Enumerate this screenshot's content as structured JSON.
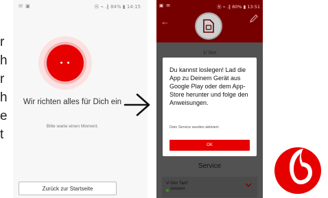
{
  "slide_text_chars": [
    "r",
    "h",
    "r",
    "h",
    "e",
    "t"
  ],
  "phone1": {
    "status_left": "✉ ▣",
    "status_right": "Ⓝ ⌁ .∥ 84% ▮ 14:15",
    "title": "Wir richten alles für Dich ein",
    "subtitle": "Bitte warte einen Moment.",
    "back_button": "Zurück zur Startseite"
  },
  "phone2": {
    "status_left": "▣ ✉",
    "status_right": "Ⓝ ⌁ .∥ 80% ▮ 13:51",
    "back_icon": "←",
    "sim_name": "1/ Sim",
    "dialog": {
      "message": "Du kannst loslegen! Lad die App zu Deinem Gerät aus Google Play oder dem App-Store herunter und folge den Anweisungen.",
      "note": "Dein Service wurden aktiviert.",
      "ok_label": "OK"
    },
    "service_heading": "Service",
    "tariff_name": "V-Sim Tarif",
    "tariff_status": "Aktiviert"
  },
  "colors": {
    "vodafone_red": "#e60000",
    "dark_header": "#760000",
    "overlay_gray": "#525252"
  },
  "icons": [
    "spinner-icon",
    "arrow-right-icon",
    "back-arrow-icon",
    "edit-icon",
    "sim-card-icon",
    "chevron-down-icon",
    "vodafone-logo"
  ]
}
